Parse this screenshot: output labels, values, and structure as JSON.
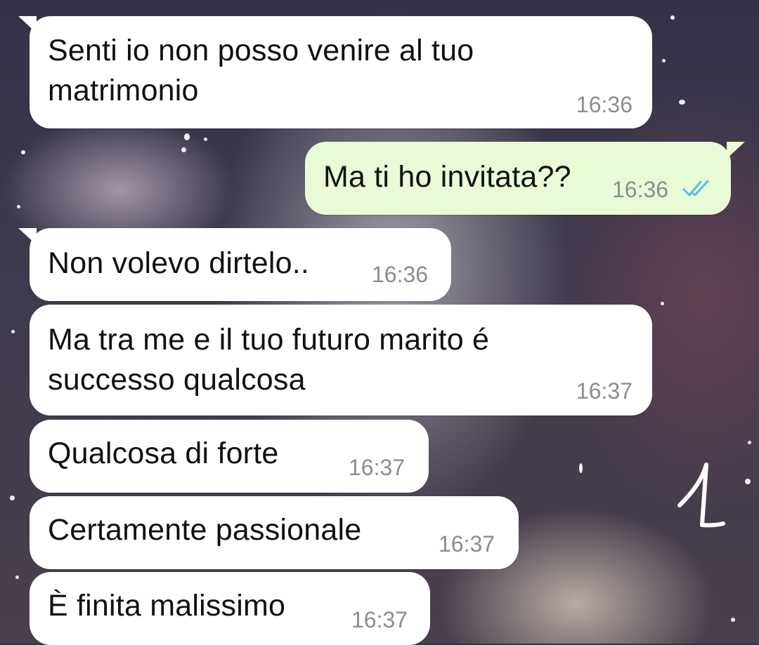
{
  "chat": {
    "messages": [
      {
        "direction": "incoming",
        "text": "Senti io non posso venire al tuo\nmatrimonio",
        "time": "16:36"
      },
      {
        "direction": "outgoing",
        "text": "Ma ti ho invitata??",
        "time": "16:36",
        "status": "read"
      },
      {
        "direction": "incoming",
        "text": "Non volevo dirtelo..",
        "time": "16:36"
      },
      {
        "direction": "incoming",
        "text": "Ma tra me e il tuo futuro marito é\nsuccesso qualcosa",
        "time": "16:37"
      },
      {
        "direction": "incoming",
        "text": "Qualcosa di forte",
        "time": "16:37"
      },
      {
        "direction": "incoming",
        "text": "Certamente passionale",
        "time": "16:37"
      },
      {
        "direction": "incoming",
        "text": "È finita malissimo",
        "time": "16:37"
      }
    ]
  },
  "annotation": {
    "mark": "1"
  },
  "colors": {
    "incoming_bubble": "#ffffff",
    "outgoing_bubble": "#e8fbd6",
    "timestamp": "#8a8e90",
    "read_ticks": "#53bdeb",
    "annotation_ink": "#ffffff"
  },
  "icons": {
    "read_receipt": "double-check-icon"
  }
}
